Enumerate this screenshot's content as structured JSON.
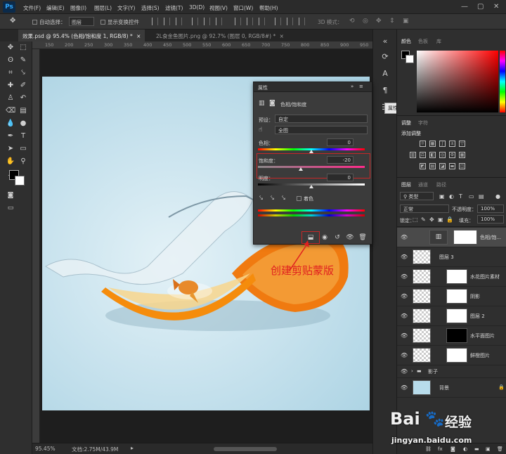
{
  "app": {
    "logo": "Ps"
  },
  "menu": [
    "文件(F)",
    "编辑(E)",
    "图像(I)",
    "图层(L)",
    "文字(Y)",
    "选择(S)",
    "滤镜(T)",
    "3D(D)",
    "视图(V)",
    "窗口(W)",
    "帮助(H)"
  ],
  "window_controls": [
    "—",
    "▢",
    "✕"
  ],
  "options": {
    "auto_select": "自动选择：",
    "target": "图层",
    "show_transform": "显示变换控件",
    "mode_3d": "3D 模式："
  },
  "tabs": [
    {
      "label": "效果.psd @ 95.4% (色相/饱和度 1, RGB/8) *",
      "close": "×"
    },
    {
      "label": "2L食金鱼图片.png @ 92.7% (图层 0, RGB/8#) *",
      "close": "×"
    }
  ],
  "ruler_top": [
    "150",
    "200",
    "250",
    "300",
    "350",
    "400",
    "450",
    "500",
    "550",
    "600",
    "650",
    "700",
    "750",
    "800",
    "850",
    "900",
    "950"
  ],
  "canvas": {
    "annotation": "创建剪贴蒙版",
    "colors": {
      "background": "#c9e3ee",
      "orange": "#f07a10",
      "annotation": "#e02020"
    }
  },
  "status": {
    "zoom": "95.45%",
    "doc": "文档:2.75M/43.9M"
  },
  "dock": {
    "tooltip": "属性"
  },
  "properties": {
    "panel_title": "属性",
    "subtitle": "色相/饱和度",
    "preset_label": "预设：",
    "preset_value": "自定",
    "channel_value": "全图",
    "hue_label": "色相：",
    "hue_value": "0",
    "sat_label": "饱和度：",
    "sat_value": "-20",
    "light_label": "明度：",
    "light_value": "0",
    "colorize_label": "着色"
  },
  "right_panels": {
    "color_tabs": [
      "颜色",
      "色板",
      "库"
    ],
    "adjust_tabs": [
      "调整",
      "字符"
    ],
    "add_adjustment": "添加调整",
    "layers_tabs": [
      "图层",
      "通道",
      "路径"
    ],
    "filter_kind": "类型",
    "blend_mode": "正常",
    "opacity_label": "不透明度：",
    "opacity_value": "100%",
    "lock_label": "锁定：",
    "fill_label": "填充：",
    "fill_value": "100%"
  },
  "layers": [
    {
      "name": "色相/饱...",
      "type": "adjustment"
    },
    {
      "name": "图层 3",
      "type": "pixel"
    },
    {
      "name": "水花图片素材",
      "type": "masked"
    },
    {
      "name": "阴影",
      "type": "masked"
    },
    {
      "name": "图层 2",
      "type": "masked"
    },
    {
      "name": "水平面图片",
      "type": "masked"
    },
    {
      "name": "鲜橙图片",
      "type": "masked"
    },
    {
      "name": "影子",
      "type": "group"
    },
    {
      "name": "背景",
      "type": "background"
    }
  ],
  "watermark": {
    "brand": "Bai",
    "brand_cn": "经验",
    "url": "jingyan.baidu.com"
  }
}
